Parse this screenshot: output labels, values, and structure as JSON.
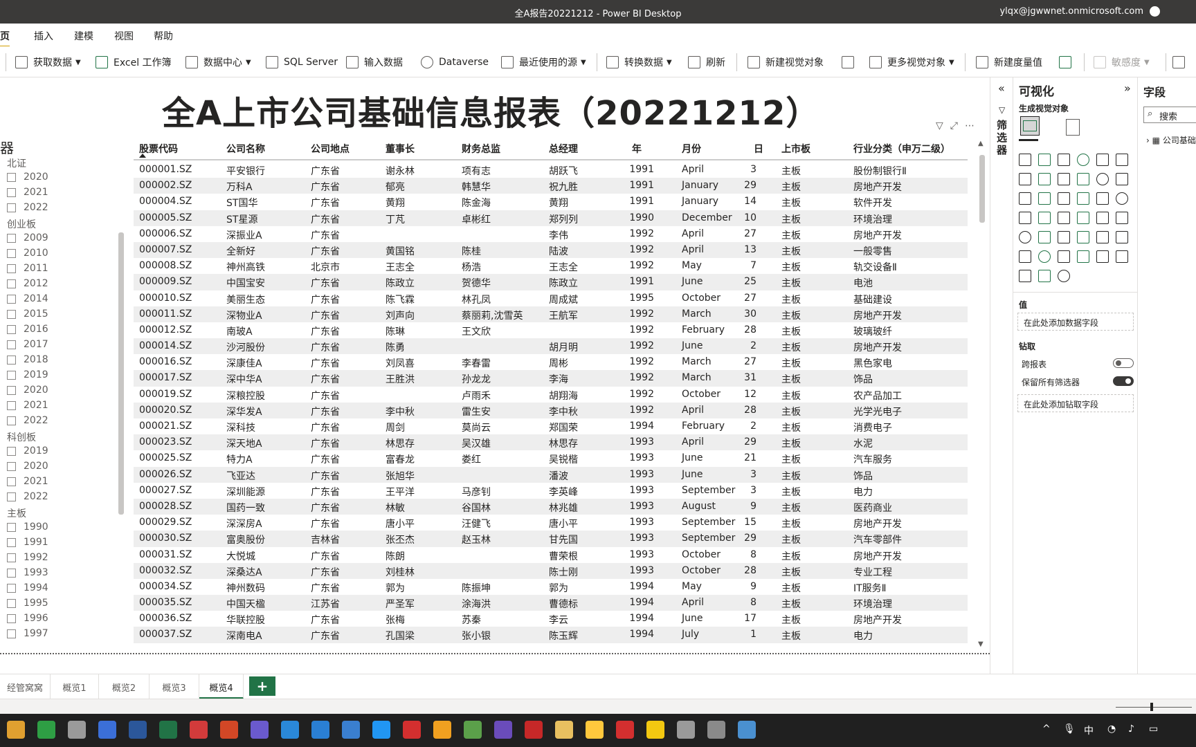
{
  "window": {
    "title": "全A报告20221212 - Power BI Desktop",
    "user": "ylqx@jgwwnet.onmicrosoft.com"
  },
  "menu": [
    "主页",
    "插入",
    "建模",
    "视图",
    "帮助"
  ],
  "ribbon": {
    "get_data": "获取数据",
    "excel": "Excel 工作簿",
    "data_hub": "数据中心",
    "sql": "SQL Server",
    "enter_data": "输入数据",
    "dataverse": "Dataverse",
    "recent": "最近使用的源",
    "transform": "转换数据",
    "refresh": "刷新",
    "new_visual": "新建视觉对象",
    "more_visuals": "更多视觉对象",
    "new_measure": "新建度量值",
    "sensitivity": "敏感度"
  },
  "report": {
    "title": "全A上市公司基础信息报表（20221212）"
  },
  "slicer": {
    "title": "器",
    "groups": [
      {
        "name": "北证",
        "years": [
          "2020",
          "2021",
          "2022"
        ]
      },
      {
        "name": "创业板",
        "years": [
          "2009",
          "2010",
          "2011",
          "2012",
          "2014",
          "2015",
          "2016",
          "2017",
          "2018",
          "2019",
          "2020",
          "2021",
          "2022"
        ]
      },
      {
        "name": "科创板",
        "years": [
          "2019",
          "2020",
          "2021",
          "2022"
        ]
      },
      {
        "name": "主板",
        "years": [
          "1990",
          "1991",
          "1992",
          "1993",
          "1994",
          "1995",
          "1996",
          "1997"
        ]
      }
    ]
  },
  "table": {
    "headers": [
      "股票代码",
      "公司名称",
      "公司地点",
      "董事长",
      "财务总监",
      "总经理",
      "年",
      "月份",
      "日",
      "上市板",
      "行业分类（申万二级）"
    ],
    "rows": [
      [
        "000001.SZ",
        "平安银行",
        "广东省",
        "谢永林",
        "项有志",
        "胡跃飞",
        "1991",
        "April",
        "3",
        "主板",
        "股份制银行Ⅱ"
      ],
      [
        "000002.SZ",
        "万科A",
        "广东省",
        "郁亮",
        "韩慧华",
        "祝九胜",
        "1991",
        "January",
        "29",
        "主板",
        "房地产开发"
      ],
      [
        "000004.SZ",
        "ST国华",
        "广东省",
        "黄翔",
        "陈金海",
        "黄翔",
        "1991",
        "January",
        "14",
        "主板",
        "软件开发"
      ],
      [
        "000005.SZ",
        "ST星源",
        "广东省",
        "丁芃",
        "卓彬红",
        "郑列列",
        "1990",
        "December",
        "10",
        "主板",
        "环境治理"
      ],
      [
        "000006.SZ",
        "深振业A",
        "广东省",
        "",
        "",
        "李伟",
        "1992",
        "April",
        "27",
        "主板",
        "房地产开发"
      ],
      [
        "000007.SZ",
        "全新好",
        "广东省",
        "黄国铭",
        "陈桂",
        "陆波",
        "1992",
        "April",
        "13",
        "主板",
        "一般零售"
      ],
      [
        "000008.SZ",
        "神州高铁",
        "北京市",
        "王志全",
        "杨浩",
        "王志全",
        "1992",
        "May",
        "7",
        "主板",
        "轨交设备Ⅱ"
      ],
      [
        "000009.SZ",
        "中国宝安",
        "广东省",
        "陈政立",
        "贺德华",
        "陈政立",
        "1991",
        "June",
        "25",
        "主板",
        "电池"
      ],
      [
        "000010.SZ",
        "美丽生态",
        "广东省",
        "陈飞霖",
        "林孔凤",
        "周成斌",
        "1995",
        "October",
        "27",
        "主板",
        "基础建设"
      ],
      [
        "000011.SZ",
        "深物业A",
        "广东省",
        "刘声向",
        "蔡丽莉,沈雪英",
        "王航军",
        "1992",
        "March",
        "30",
        "主板",
        "房地产开发"
      ],
      [
        "000012.SZ",
        "南玻A",
        "广东省",
        "陈琳",
        "王文欣",
        "",
        "1992",
        "February",
        "28",
        "主板",
        "玻璃玻纤"
      ],
      [
        "000014.SZ",
        "沙河股份",
        "广东省",
        "陈勇",
        "",
        "胡月明",
        "1992",
        "June",
        "2",
        "主板",
        "房地产开发"
      ],
      [
        "000016.SZ",
        "深康佳A",
        "广东省",
        "刘凤喜",
        "李春雷",
        "周彬",
        "1992",
        "March",
        "27",
        "主板",
        "黑色家电"
      ],
      [
        "000017.SZ",
        "深中华A",
        "广东省",
        "王胜洪",
        "孙龙龙",
        "李海",
        "1992",
        "March",
        "31",
        "主板",
        "饰品"
      ],
      [
        "000019.SZ",
        "深粮控股",
        "广东省",
        "",
        "卢雨禾",
        "胡翔海",
        "1992",
        "October",
        "12",
        "主板",
        "农产品加工"
      ],
      [
        "000020.SZ",
        "深华发A",
        "广东省",
        "李中秋",
        "雷生安",
        "李中秋",
        "1992",
        "April",
        "28",
        "主板",
        "光学光电子"
      ],
      [
        "000021.SZ",
        "深科技",
        "广东省",
        "周剑",
        "莫尚云",
        "郑国荣",
        "1994",
        "February",
        "2",
        "主板",
        "消费电子"
      ],
      [
        "000023.SZ",
        "深天地A",
        "广东省",
        "林思存",
        "吴汉雄",
        "林思存",
        "1993",
        "April",
        "29",
        "主板",
        "水泥"
      ],
      [
        "000025.SZ",
        "特力A",
        "广东省",
        "富春龙",
        "娄红",
        "吴锐楷",
        "1993",
        "June",
        "21",
        "主板",
        "汽车服务"
      ],
      [
        "000026.SZ",
        "飞亚达",
        "广东省",
        "张旭华",
        "",
        "潘波",
        "1993",
        "June",
        "3",
        "主板",
        "饰品"
      ],
      [
        "000027.SZ",
        "深圳能源",
        "广东省",
        "王平洋",
        "马彦钊",
        "李英峰",
        "1993",
        "September",
        "3",
        "主板",
        "电力"
      ],
      [
        "000028.SZ",
        "国药一致",
        "广东省",
        "林敏",
        "谷国林",
        "林兆雄",
        "1993",
        "August",
        "9",
        "主板",
        "医药商业"
      ],
      [
        "000029.SZ",
        "深深房A",
        "广东省",
        "唐小平",
        "汪健飞",
        "唐小平",
        "1993",
        "September",
        "15",
        "主板",
        "房地产开发"
      ],
      [
        "000030.SZ",
        "富奥股份",
        "吉林省",
        "张丕杰",
        "赵玉林",
        "甘先国",
        "1993",
        "September",
        "29",
        "主板",
        "汽车零部件"
      ],
      [
        "000031.SZ",
        "大悦城",
        "广东省",
        "陈朗",
        "",
        "曹荣根",
        "1993",
        "October",
        "8",
        "主板",
        "房地产开发"
      ],
      [
        "000032.SZ",
        "深桑达A",
        "广东省",
        "刘桂林",
        "",
        "陈士刚",
        "1993",
        "October",
        "28",
        "主板",
        "专业工程"
      ],
      [
        "000034.SZ",
        "神州数码",
        "广东省",
        "郭为",
        "陈振坤",
        "郭为",
        "1994",
        "May",
        "9",
        "主板",
        "IT服务Ⅱ"
      ],
      [
        "000035.SZ",
        "中国天楹",
        "江苏省",
        "严圣军",
        "涂海洪",
        "曹德标",
        "1994",
        "April",
        "8",
        "主板",
        "环境治理"
      ],
      [
        "000036.SZ",
        "华联控股",
        "广东省",
        "张梅",
        "苏秦",
        "李云",
        "1994",
        "June",
        "17",
        "主板",
        "房地产开发"
      ],
      [
        "000037.SZ",
        "深南电A",
        "广东省",
        "孔国梁",
        "张小银",
        "陈玉辉",
        "1994",
        "July",
        "1",
        "主板",
        "电力"
      ]
    ]
  },
  "filters_pane": {
    "label": "筛选器"
  },
  "viz_pane": {
    "title": "可视化",
    "build_label": "生成视觉对象",
    "values_label": "值",
    "values_well": "在此处添加数据字段",
    "drill_label": "钻取",
    "cross_report": "跨报表",
    "keep_filters": "保留所有筛选器",
    "drill_well": "在此处添加钻取字段"
  },
  "fields_pane": {
    "title": "字段",
    "search_placeholder": "搜索",
    "table_name": "公司基础"
  },
  "pages": [
    "经管窝窝",
    "概览1",
    "概览2",
    "概览3",
    "概览4"
  ],
  "tray": {
    "ime": "中"
  },
  "colors": {
    "accent": "#217346",
    "titlebar": "#3b3a39",
    "taskbar": "#202020",
    "row_alt": "#eeeeee"
  }
}
